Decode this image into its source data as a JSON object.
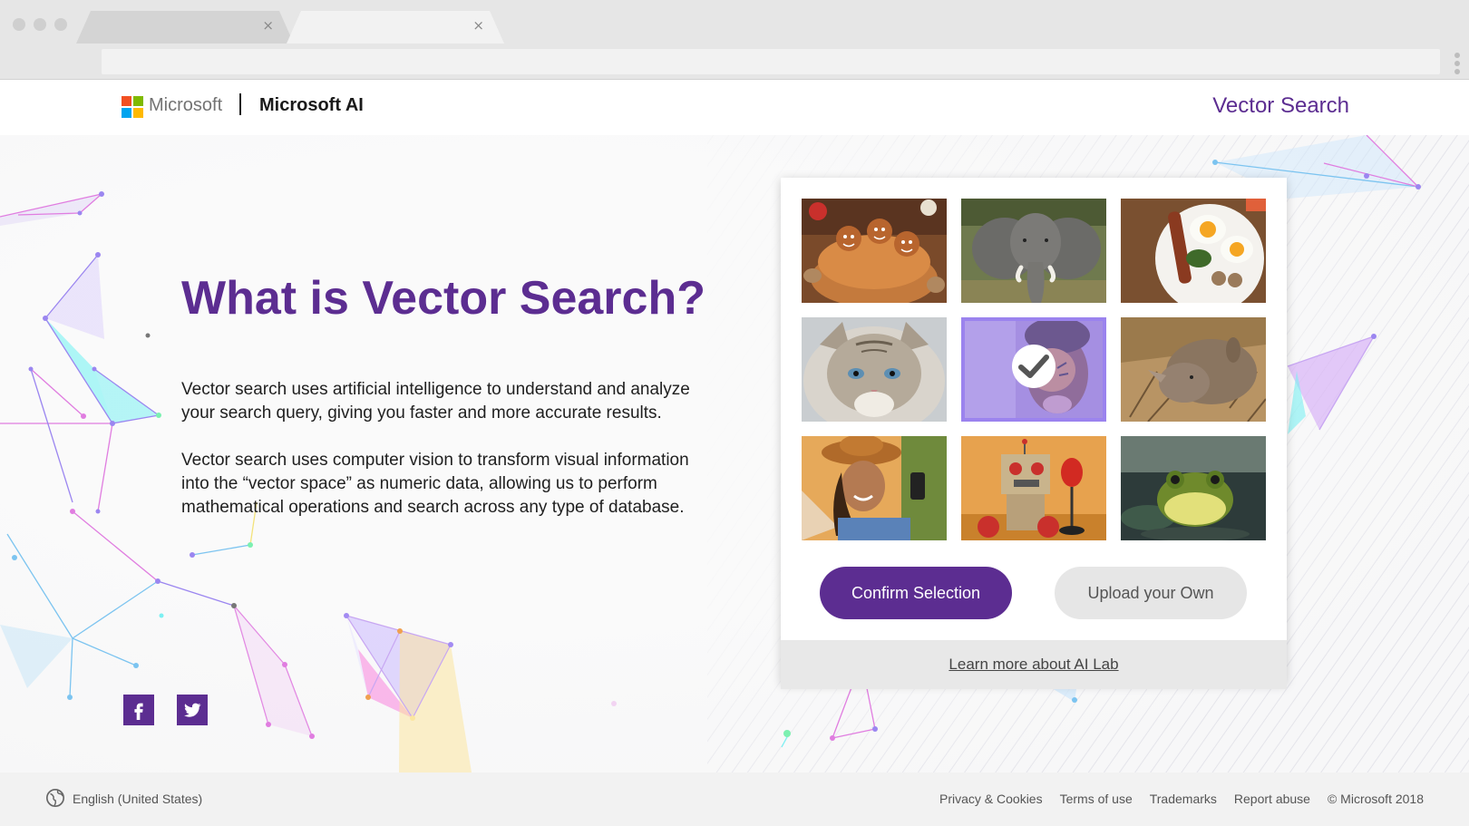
{
  "header": {
    "company_name": "Microsoft",
    "brand": "Microsoft AI",
    "product": "Vector Search"
  },
  "hero": {
    "title": "What is Vector Search?",
    "paragraph1": "Vector search uses artificial intelligence to understand and analyze your search query, giving you faster and more accurate results.",
    "paragraph2": "Vector search uses computer vision to transform visual information into the “vector space” as numeric data, allowing us to perform mathematical operations and search across any type of database."
  },
  "picker": {
    "images": [
      {
        "name": "gingerbread-cookies",
        "selected": false
      },
      {
        "name": "elephant",
        "selected": false
      },
      {
        "name": "breakfast-plate",
        "selected": false
      },
      {
        "name": "cat",
        "selected": false
      },
      {
        "name": "face-painted-child",
        "selected": true
      },
      {
        "name": "rhinoceros",
        "selected": false
      },
      {
        "name": "woman-with-phone",
        "selected": false
      },
      {
        "name": "toy-robot-boxing",
        "selected": false
      },
      {
        "name": "frog",
        "selected": false
      }
    ],
    "confirm_label": "Confirm Selection",
    "upload_label": "Upload your Own",
    "learn_more": "Learn more about AI Lab"
  },
  "social": {
    "icons": [
      "facebook-icon",
      "twitter-icon"
    ]
  },
  "footer": {
    "locale": "English (United States)",
    "links": [
      "Privacy & Cookies",
      "Terms of use",
      "Trademarks",
      "Report abuse",
      "© Microsoft 2018"
    ]
  },
  "colors": {
    "brand_purple": "#5c2d91",
    "selection_outline": "#a38bf2",
    "ms_red": "#f25022",
    "ms_green": "#7fba00",
    "ms_blue": "#00a4ef",
    "ms_yellow": "#ffb900"
  }
}
